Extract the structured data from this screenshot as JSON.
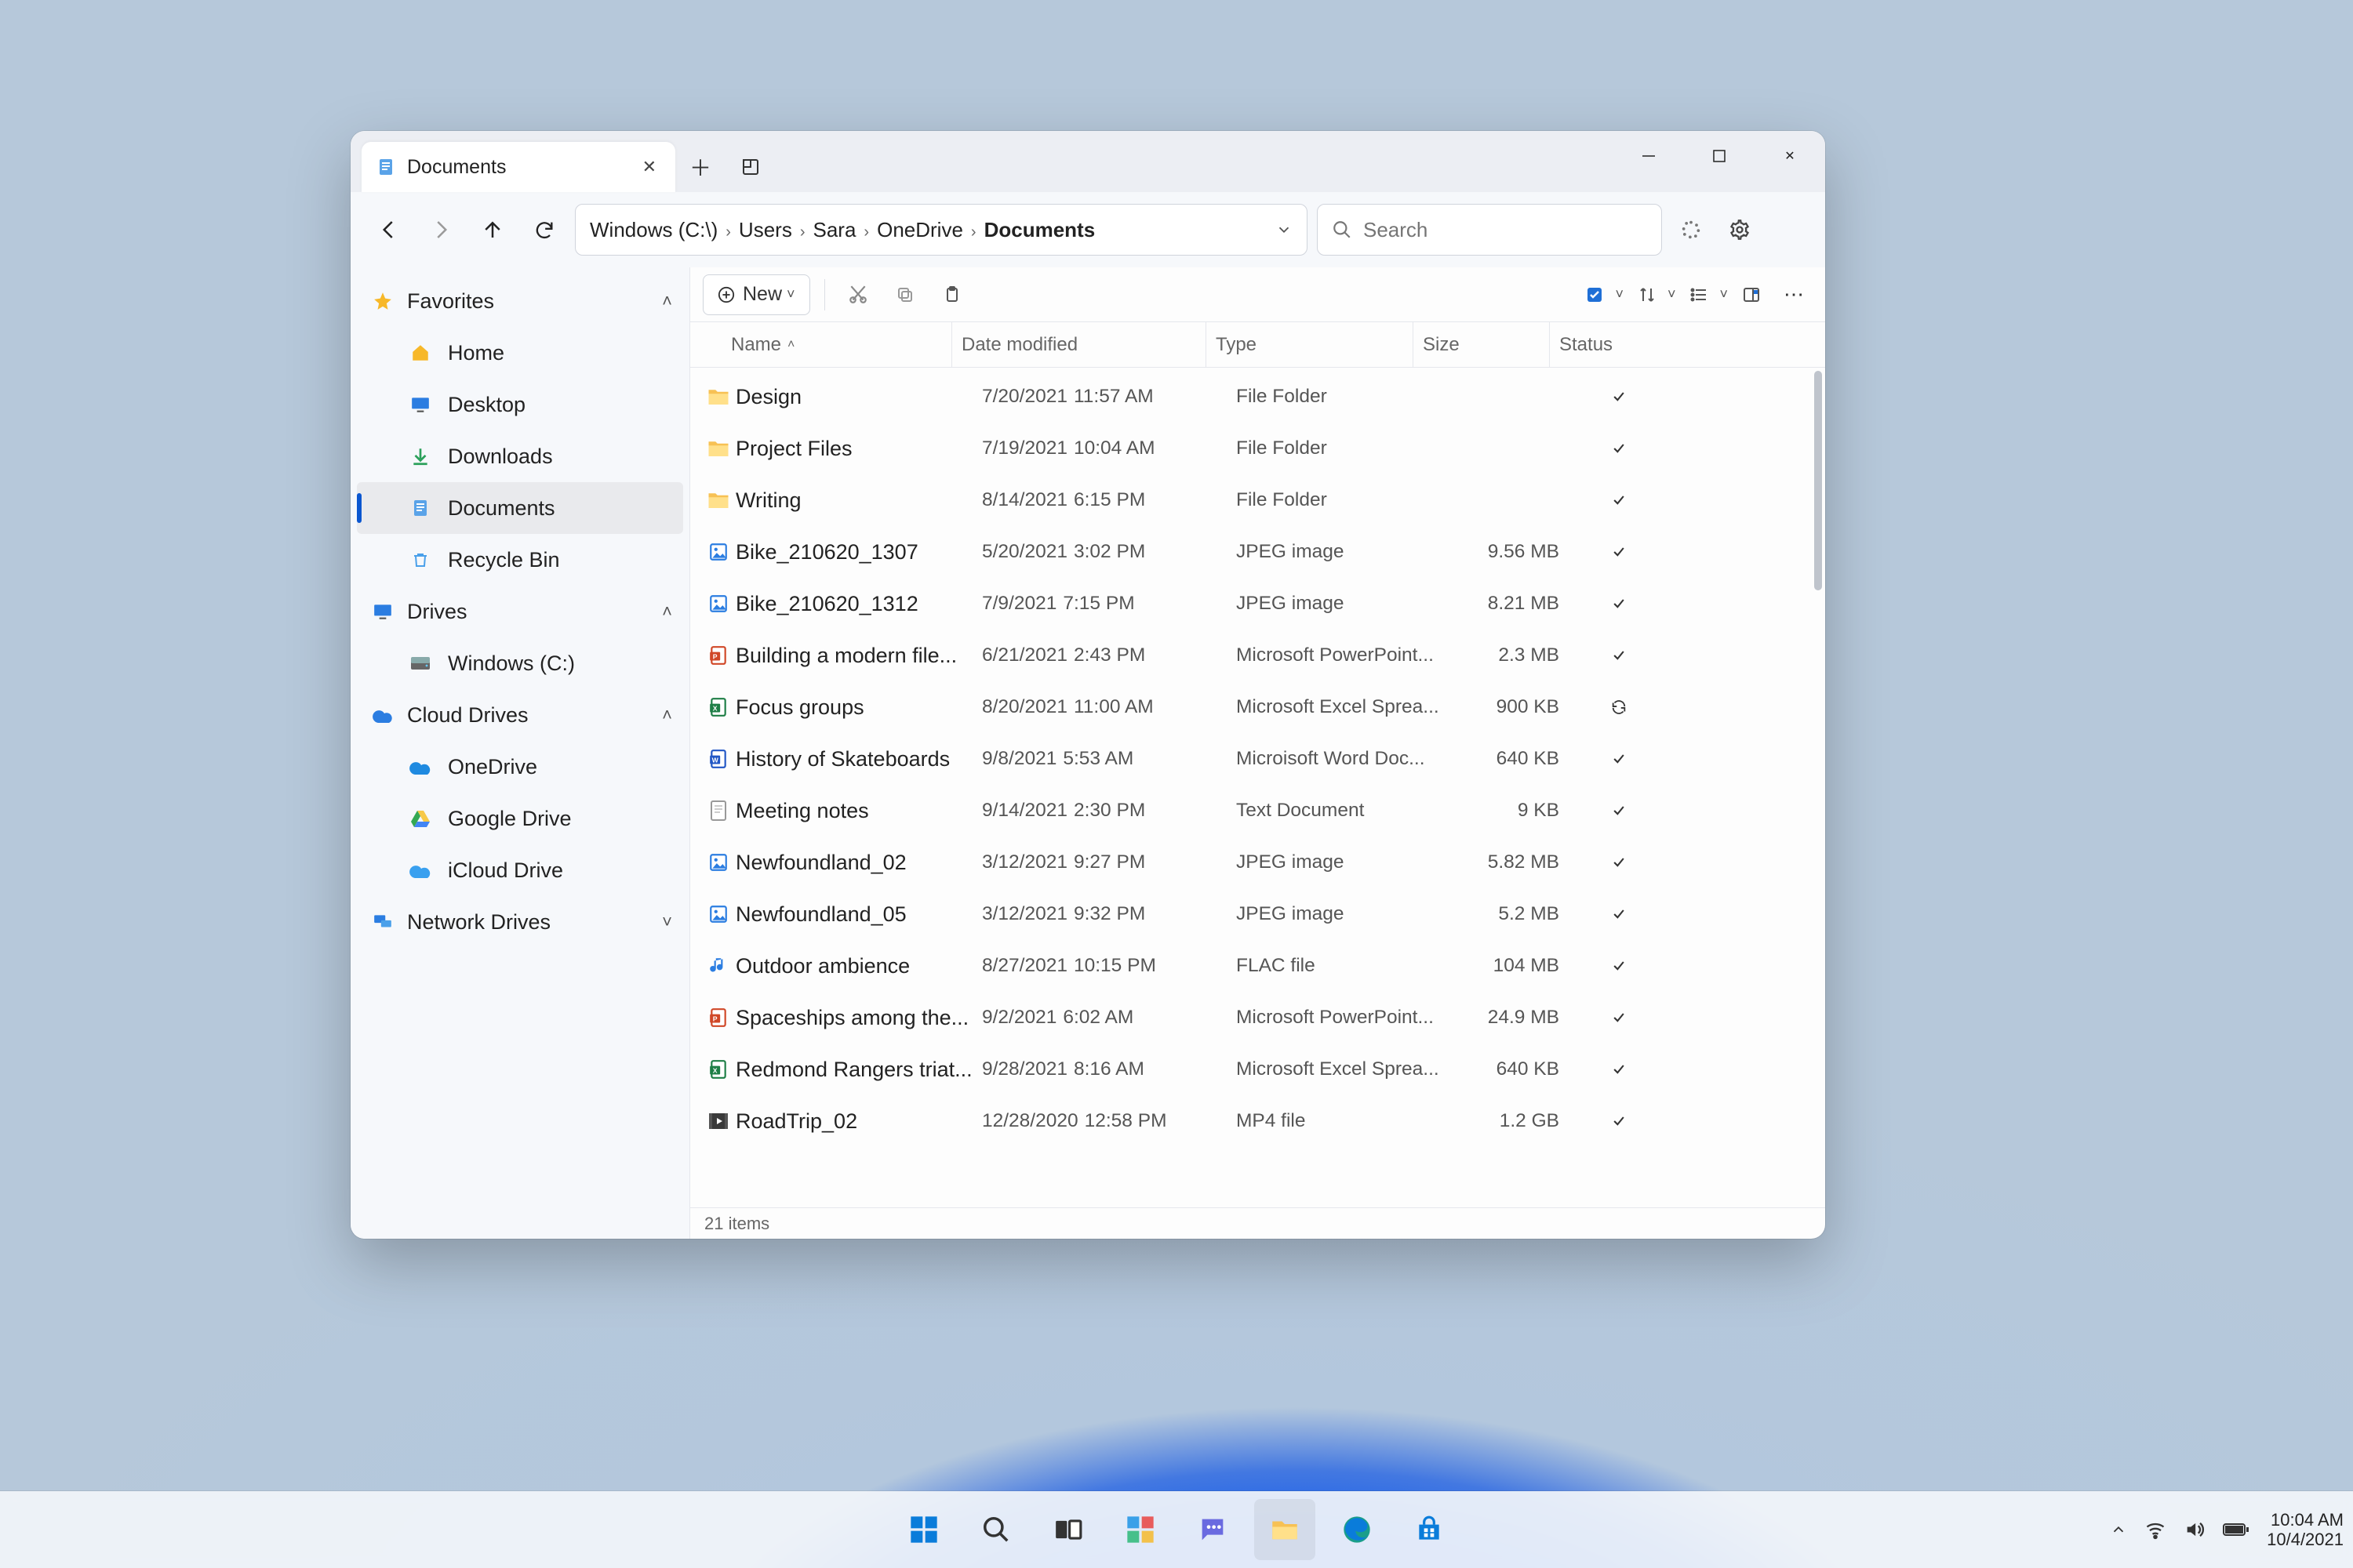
{
  "tab": {
    "title": "Documents"
  },
  "breadcrumb": [
    "Windows (C:\\)",
    "Users",
    "Sara",
    "OneDrive",
    "Documents"
  ],
  "search": {
    "placeholder": "Search"
  },
  "toolbar": {
    "new_label": "New"
  },
  "sidebar": {
    "headers": {
      "favorites": "Favorites",
      "drives": "Drives",
      "cloud": "Cloud Drives",
      "network": "Network Drives"
    },
    "favorites": [
      {
        "label": "Home",
        "icon": "home-icon"
      },
      {
        "label": "Desktop",
        "icon": "desktop-icon"
      },
      {
        "label": "Downloads",
        "icon": "downloads-icon"
      },
      {
        "label": "Documents",
        "icon": "documents-icon",
        "selected": true
      },
      {
        "label": "Recycle Bin",
        "icon": "recycle-bin-icon"
      }
    ],
    "drives": [
      {
        "label": "Windows (C:)"
      }
    ],
    "cloud": [
      {
        "label": "OneDrive"
      },
      {
        "label": "Google Drive"
      },
      {
        "label": "iCloud Drive"
      }
    ],
    "network": []
  },
  "columns": {
    "name": "Name",
    "date": "Date modified",
    "type": "Type",
    "size": "Size",
    "status": "Status"
  },
  "files": [
    {
      "icon": "folder",
      "name": "Design",
      "date": "7/20/2021",
      "time": "11:57 AM",
      "type": "File Folder",
      "size": "",
      "status": "check"
    },
    {
      "icon": "folder",
      "name": "Project Files",
      "date": "7/19/2021",
      "time": "10:04 AM",
      "type": "File Folder",
      "size": "",
      "status": "check"
    },
    {
      "icon": "folder",
      "name": "Writing",
      "date": "8/14/2021",
      "time": "6:15 PM",
      "type": "File Folder",
      "size": "",
      "status": "check"
    },
    {
      "icon": "image",
      "name": "Bike_210620_1307",
      "date": "5/20/2021",
      "time": "3:02 PM",
      "type": "JPEG image",
      "size": "9.56 MB",
      "status": "check"
    },
    {
      "icon": "image",
      "name": "Bike_210620_1312",
      "date": "7/9/2021",
      "time": "7:15 PM",
      "type": "JPEG image",
      "size": "8.21 MB",
      "status": "check"
    },
    {
      "icon": "ppt",
      "name": "Building a modern file...",
      "date": "6/21/2021",
      "time": "2:43 PM",
      "type": "Microsoft PowerPoint...",
      "size": "2.3 MB",
      "status": "check"
    },
    {
      "icon": "xls",
      "name": "Focus groups",
      "date": "8/20/2021",
      "time": "11:00 AM",
      "type": "Microsoft Excel Sprea...",
      "size": "900 KB",
      "status": "sync"
    },
    {
      "icon": "doc",
      "name": "History of Skateboards",
      "date": "9/8/2021",
      "time": "5:53 AM",
      "type": "Microisoft Word Doc...",
      "size": "640 KB",
      "status": "check"
    },
    {
      "icon": "txt",
      "name": "Meeting notes",
      "date": "9/14/2021",
      "time": "2:30 PM",
      "type": "Text Document",
      "size": "9 KB",
      "status": "check"
    },
    {
      "icon": "image",
      "name": "Newfoundland_02",
      "date": "3/12/2021",
      "time": "9:27 PM",
      "type": "JPEG image",
      "size": "5.82 MB",
      "status": "check"
    },
    {
      "icon": "image",
      "name": "Newfoundland_05",
      "date": "3/12/2021",
      "time": "9:32 PM",
      "type": "JPEG image",
      "size": "5.2 MB",
      "status": "check"
    },
    {
      "icon": "audio",
      "name": "Outdoor ambience",
      "date": "8/27/2021",
      "time": "10:15 PM",
      "type": "FLAC file",
      "size": "104 MB",
      "status": "check"
    },
    {
      "icon": "ppt",
      "name": "Spaceships among the...",
      "date": "9/2/2021",
      "time": "6:02 AM",
      "type": "Microsoft PowerPoint...",
      "size": "24.9 MB",
      "status": "check"
    },
    {
      "icon": "xls",
      "name": "Redmond Rangers triat...",
      "date": "9/28/2021",
      "time": "8:16 AM",
      "type": "Microsoft Excel Sprea...",
      "size": "640 KB",
      "status": "check"
    },
    {
      "icon": "video",
      "name": "RoadTrip_02",
      "date": "12/28/2020",
      "time": "12:58 PM",
      "type": "MP4 file",
      "size": "1.2 GB",
      "status": "check"
    }
  ],
  "status_bar": {
    "item_count": "21 items"
  },
  "system_tray": {
    "time": "10:04 AM",
    "date": "10/4/2021"
  }
}
